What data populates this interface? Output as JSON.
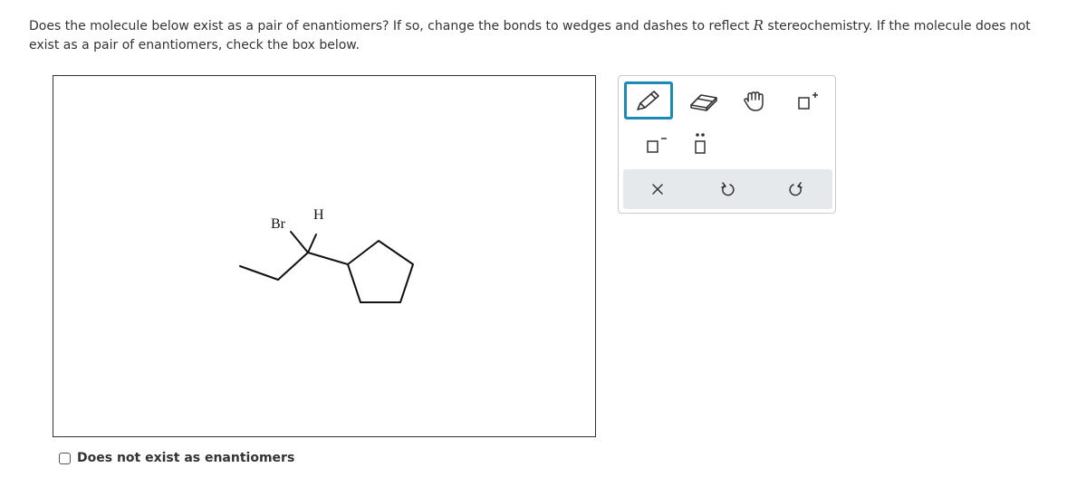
{
  "question": {
    "text_part1": "Does the molecule below exist as a pair of enantiomers? If so, change the bonds to wedges and dashes to reflect ",
    "stereo_label": "R",
    "text_part2": " stereochemistry. If the molecule does not exist as a pair of enantiomers, check the box below."
  },
  "molecule": {
    "atom_labels": {
      "bromine": "Br",
      "hydrogen": "H"
    }
  },
  "toolbox": {
    "tools": [
      {
        "name": "pencil-tool",
        "icon": "pencil-icon",
        "selected": true
      },
      {
        "name": "eraser-tool",
        "icon": "eraser-icon",
        "selected": false
      },
      {
        "name": "move-tool",
        "icon": "hand-icon",
        "selected": false
      },
      {
        "name": "increase-charge-tool",
        "icon": "positive-charge-icon",
        "selected": false
      },
      {
        "name": "decrease-charge-tool",
        "icon": "negative-charge-icon",
        "selected": false
      },
      {
        "name": "lone-pair-tool",
        "icon": "lone-pair-icon",
        "selected": false
      }
    ],
    "actions": [
      {
        "name": "clear-button",
        "icon": "close-icon"
      },
      {
        "name": "undo-button",
        "icon": "undo-icon"
      },
      {
        "name": "redo-button",
        "icon": "redo-icon"
      }
    ],
    "accent_color": "#1e8bb5"
  },
  "checkbox": {
    "label": "Does not exist as enantiomers",
    "checked": false
  }
}
